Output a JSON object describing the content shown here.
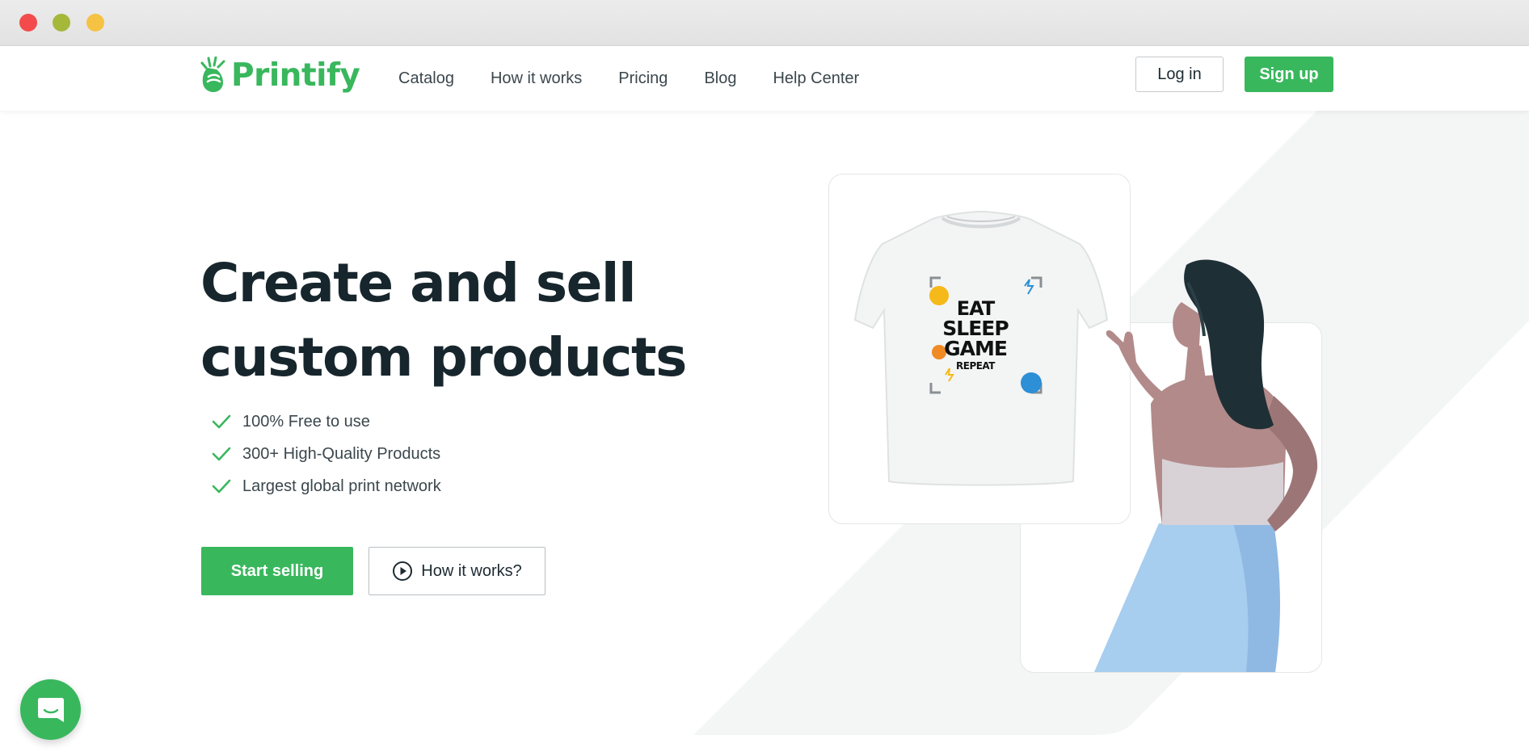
{
  "brand": {
    "name": "Printify",
    "color": "#39b75d"
  },
  "nav": {
    "items": [
      {
        "label": "Catalog"
      },
      {
        "label": "How it works"
      },
      {
        "label": "Pricing"
      },
      {
        "label": "Blog"
      },
      {
        "label": "Help Center"
      }
    ],
    "login_label": "Log in",
    "signup_label": "Sign up"
  },
  "hero": {
    "headline_line1": "Create and sell",
    "headline_line2": "custom products",
    "features": [
      "100% Free to use",
      "300+ High-Quality Products",
      "Largest global print network"
    ],
    "primary_cta": "Start selling",
    "secondary_cta": "How it works?"
  },
  "illustration": {
    "tshirt_print_lines": [
      "EAT",
      "SLEEP",
      "GAME",
      "REPEAT"
    ],
    "icons": [
      "tshirt-image",
      "woman-pointing-illustration"
    ]
  },
  "chat": {
    "icon": "chat-icon"
  },
  "window": {
    "controls": [
      "close",
      "minimize",
      "zoom"
    ]
  }
}
